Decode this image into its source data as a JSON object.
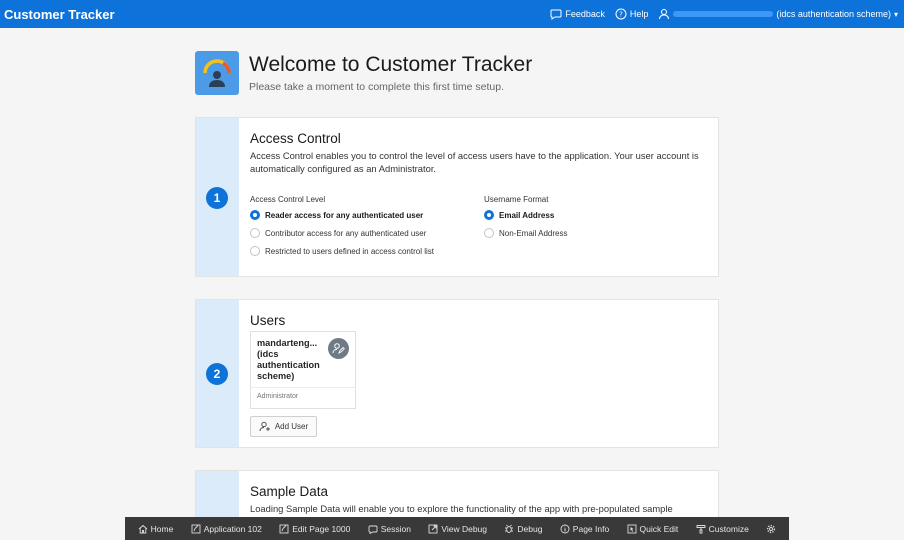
{
  "topbar": {
    "app_title": "Customer Tracker",
    "feedback": "Feedback",
    "help": "Help",
    "user_suffix": "(idcs authentication scheme)"
  },
  "header": {
    "title": "Welcome to Customer Tracker",
    "subtitle": "Please take a moment to complete this first time setup."
  },
  "access": {
    "step": "1",
    "heading": "Access Control",
    "description": "Access Control enables you to control the level of access users have to the application. Your user account is automatically configured as an Administrator.",
    "level_label": "Access Control Level",
    "levels": [
      {
        "label": "Reader access for any authenticated user",
        "selected": true
      },
      {
        "label": "Contributor access for any authenticated user",
        "selected": false
      },
      {
        "label": "Restricted to users defined in access control list",
        "selected": false
      }
    ],
    "format_label": "Username Format",
    "formats": [
      {
        "label": "Email Address",
        "selected": true
      },
      {
        "label": "Non-Email Address",
        "selected": false
      }
    ]
  },
  "users": {
    "step": "2",
    "heading": "Users",
    "user_name": "mandarteng... (idcs authentication scheme)",
    "user_role": "Administrator",
    "add_user": "Add User"
  },
  "sample": {
    "step": "3",
    "heading": "Sample Data",
    "description": "Loading Sample Data will enable you to explore the functionality of the app with pre-populated sample"
  },
  "devbar": {
    "home": "Home",
    "application": "Application 102",
    "edit_page": "Edit Page 1000",
    "session": "Session",
    "view_debug": "View Debug",
    "debug": "Debug",
    "page_info": "Page Info",
    "quick_edit": "Quick Edit",
    "customize": "Customize"
  },
  "colors": {
    "brand": "#0d73da",
    "rail": "#dcebfa",
    "devbar": "#393939"
  }
}
